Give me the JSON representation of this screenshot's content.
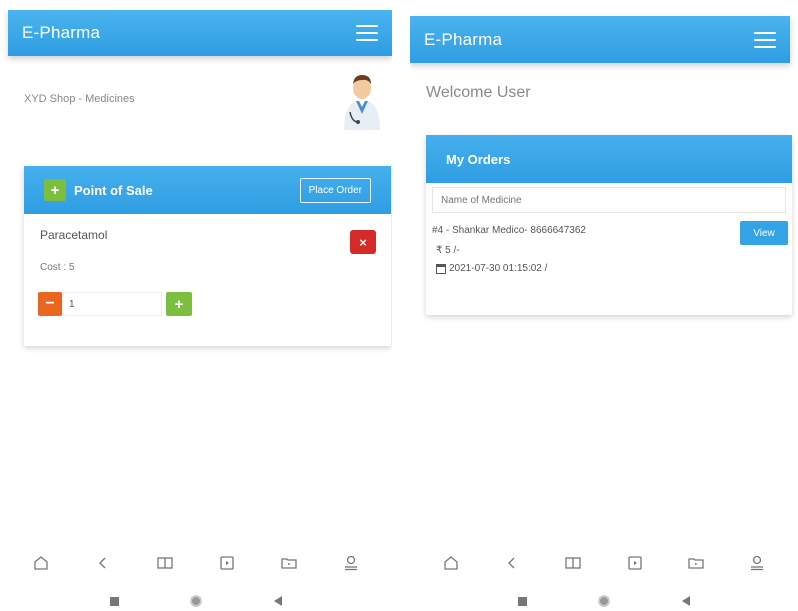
{
  "left_screen": {
    "app_title": "E-Pharma",
    "shop_title": "XYD Shop - Medicines",
    "pos_card": {
      "title": "Point of Sale",
      "place_order_label": "Place Order",
      "add_symbol": "+",
      "item": {
        "name": "Paracetamol",
        "cost": "Cost : 5",
        "remove_symbol": "×",
        "quantity": "1",
        "minus_symbol": "−",
        "plus_symbol": "+"
      }
    }
  },
  "right_screen": {
    "app_title": "E-Pharma",
    "welcome": "Welcome User",
    "orders_card": {
      "title": "My Orders",
      "search_placeholder": "Name of Medicine",
      "order": {
        "line1": "#4 - Shankar Medico- 8666647362",
        "price": "₹ 5 /-",
        "date": "2021-07-30 01:15:02 /",
        "view_label": "View"
      }
    }
  },
  "bottom_nav_icons": [
    "home-icon",
    "back-chevron-icon",
    "book-icon",
    "media-icon",
    "folder-icon",
    "profile-icon"
  ],
  "colors": {
    "primary": "#2f9de3",
    "green": "#7cbf3f",
    "red": "#d42a28",
    "orange": "#e9661e"
  }
}
